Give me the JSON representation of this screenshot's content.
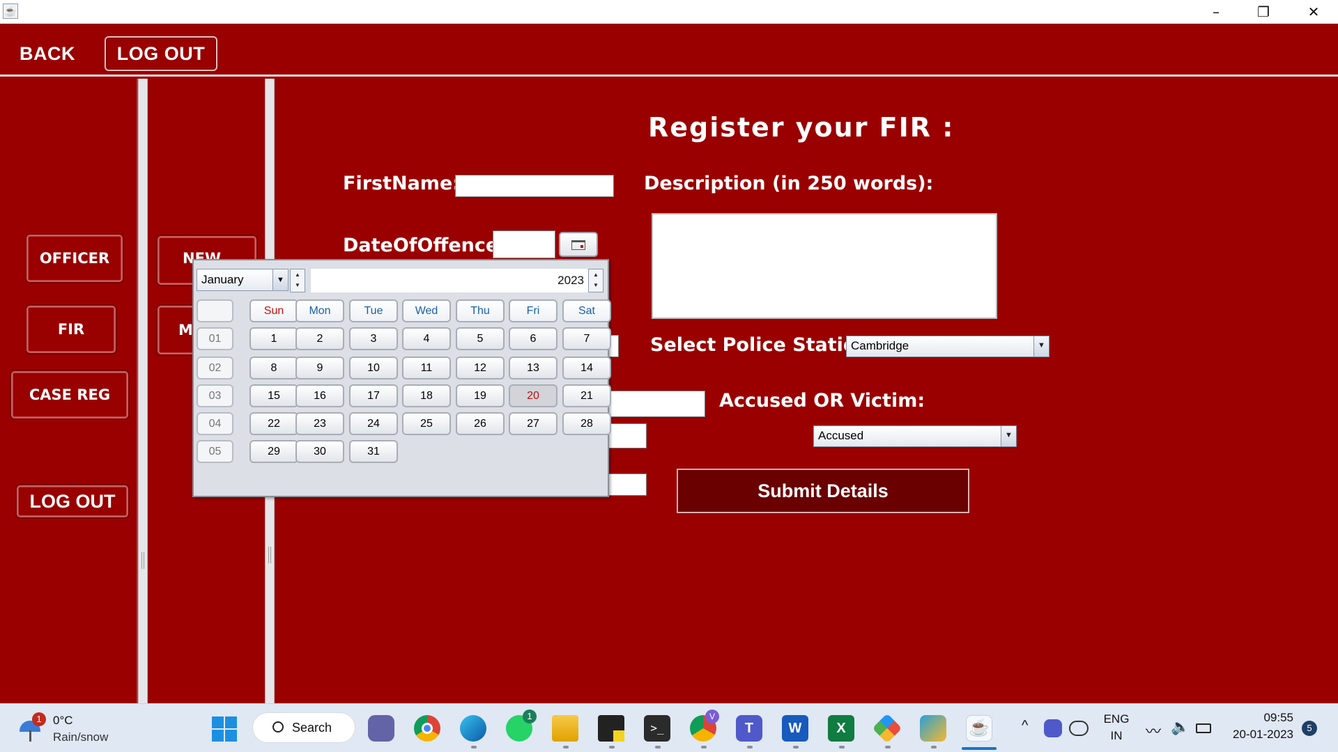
{
  "titlebar": {
    "app_icon": "java-cup-icon",
    "minimize": "–",
    "restore": "❐",
    "close": "✕"
  },
  "header": {
    "back_label": "BACK",
    "logout_label": "LOG OUT"
  },
  "sidebar": {
    "officer_label": "OFFICER",
    "fir_label": "FIR",
    "case_reg_label": "CASE REG",
    "logout_label": "LOG OUT"
  },
  "panel2": {
    "new_label": "NEW",
    "ma_label": "MA"
  },
  "form": {
    "title": "Register your FIR :",
    "firstname_label": "FirstName:",
    "firstname_value": "",
    "date_label": "DateOfOffence:",
    "date_value": "",
    "description_label": "Description (in 250 words):",
    "description_value": "",
    "police_station_label": "Select Police Station:",
    "police_station_value": "Cambridge",
    "accused_label": "Accused OR Victim:",
    "accused_value": "Accused",
    "submit_label": "Submit Details"
  },
  "calendar": {
    "month": "January",
    "year": "2023",
    "weekdays": [
      "Sun",
      "Mon",
      "Tue",
      "Wed",
      "Thu",
      "Fri",
      "Sat"
    ],
    "weeks": [
      {
        "week": "01",
        "days": [
          "1",
          "2",
          "3",
          "4",
          "5",
          "6",
          "7"
        ]
      },
      {
        "week": "02",
        "days": [
          "8",
          "9",
          "10",
          "11",
          "12",
          "13",
          "14"
        ]
      },
      {
        "week": "03",
        "days": [
          "15",
          "16",
          "17",
          "18",
          "19",
          "20",
          "21"
        ]
      },
      {
        "week": "04",
        "days": [
          "22",
          "23",
          "24",
          "25",
          "26",
          "27",
          "28"
        ]
      },
      {
        "week": "05",
        "days": [
          "29",
          "30",
          "31"
        ]
      }
    ],
    "selected_day": "20"
  },
  "taskbar": {
    "weather_temp": "0°C",
    "weather_desc": "Rain/snow",
    "weather_badge": "1",
    "search_label": "Search",
    "whatsapp_badge": "1",
    "chrome_profile_badge": "V",
    "lang_line1": "ENG",
    "lang_line2": "IN",
    "time": "09:55",
    "date": "20-01-2023",
    "notification_count": "5"
  },
  "colors": {
    "app_background": "#9a0000",
    "submit_background": "#6a0000",
    "weekday_text": "#1a5fa8",
    "sunday_text": "#c01010",
    "taskbar_background": "#dfe8f3"
  }
}
